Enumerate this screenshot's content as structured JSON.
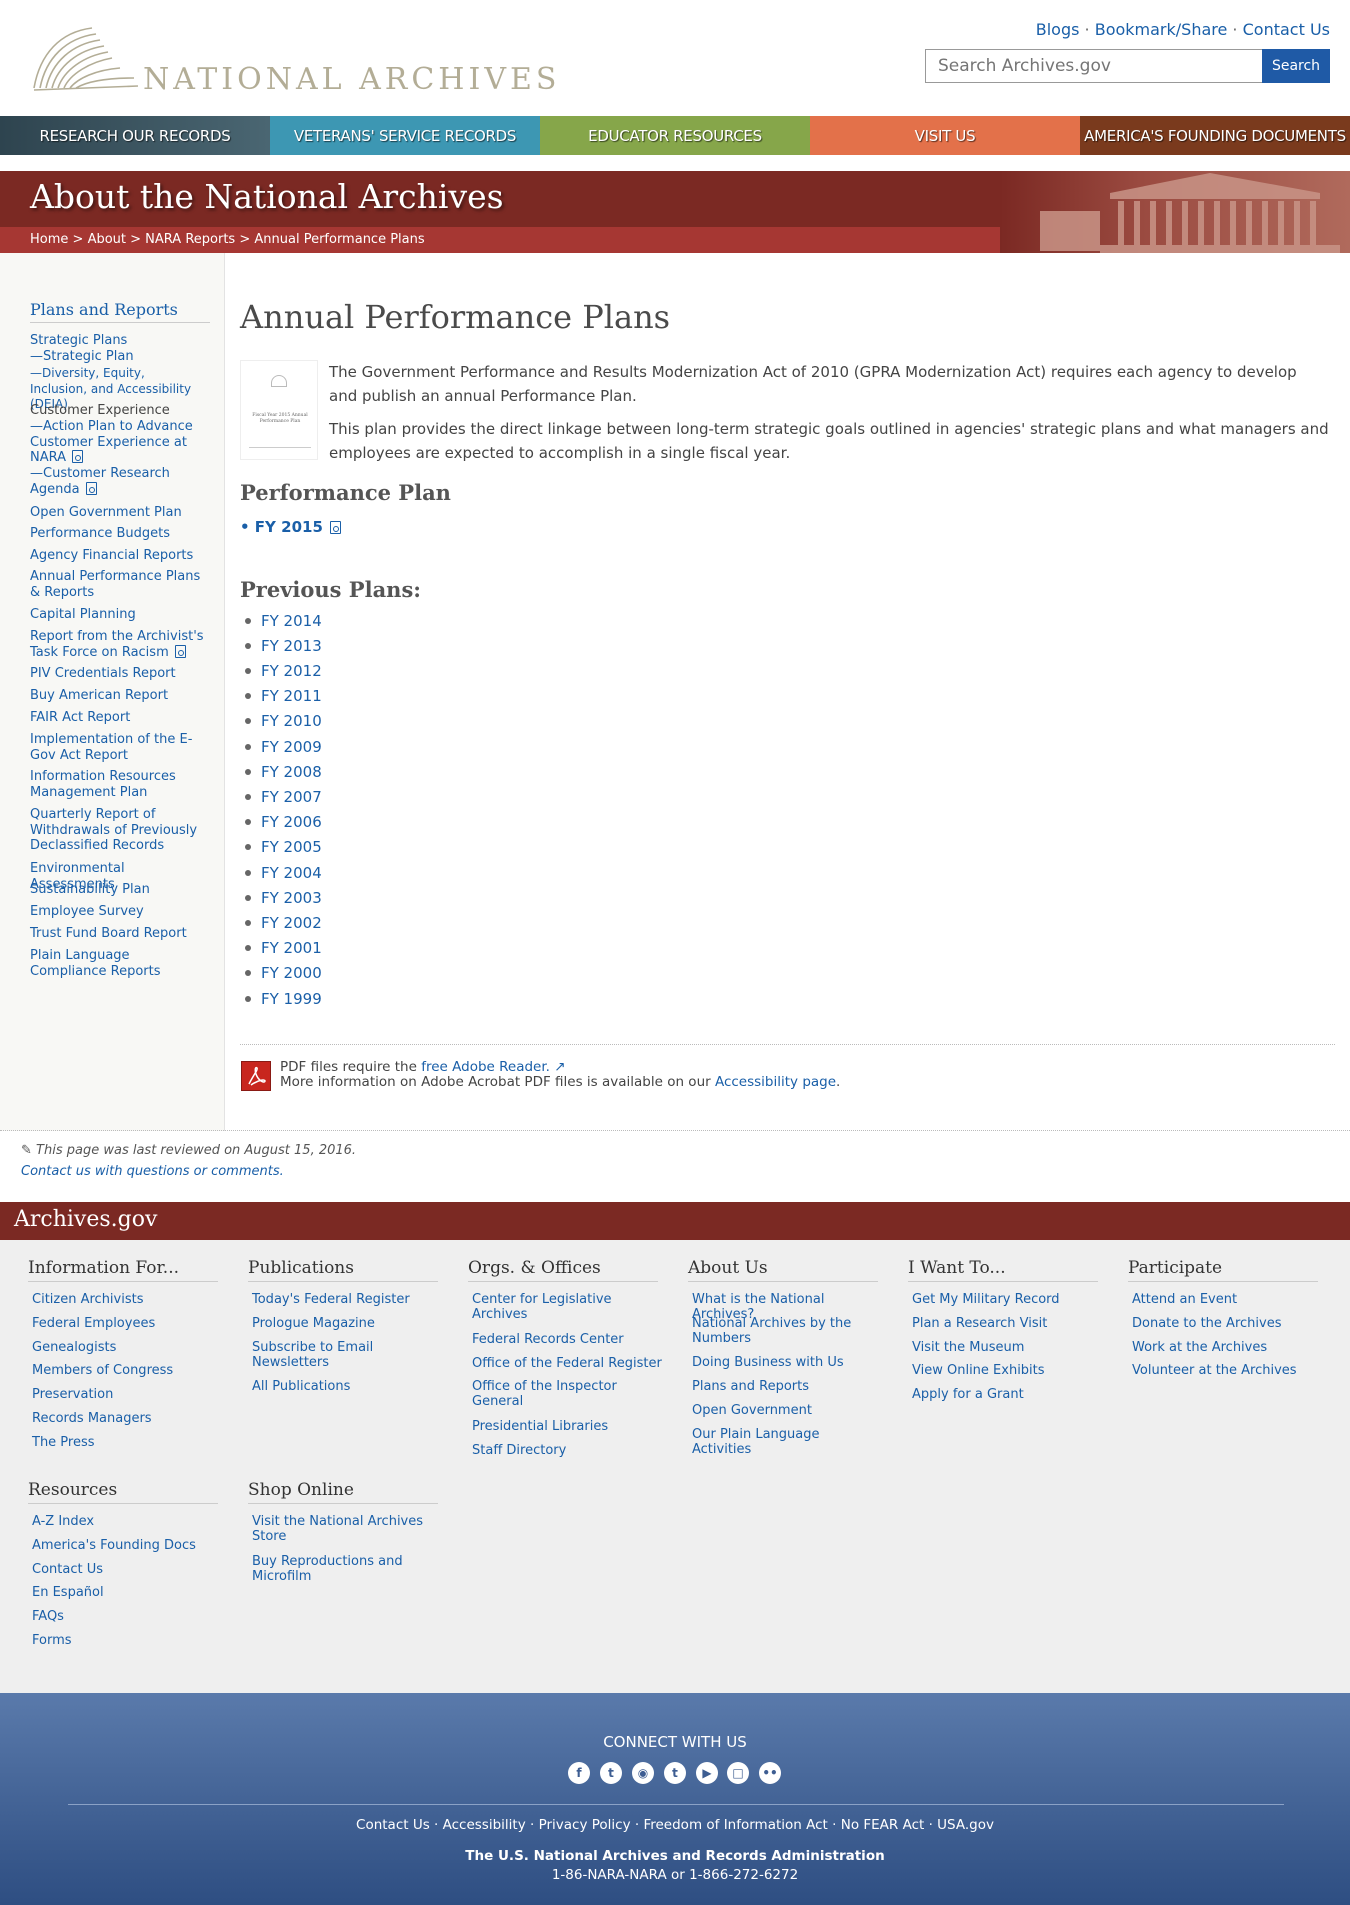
{
  "header": {
    "logo_text": "NATIONAL ARCHIVES",
    "utility": [
      "Blogs",
      "Bookmark/Share",
      "Contact Us"
    ],
    "search_placeholder": "Search Archives.gov",
    "search_button": "Search"
  },
  "nav": [
    {
      "label": "RESEARCH OUR RECORDS",
      "color": "#3e5a68"
    },
    {
      "label": "VETERANS' SERVICE RECORDS",
      "color": "#3d97b3"
    },
    {
      "label": "EDUCATOR RESOURCES",
      "color": "#86a64a"
    },
    {
      "label": "VISIT US",
      "color": "#e3714a"
    },
    {
      "label": "AMERICA'S FOUNDING DOCUMENTS",
      "color": "#7a3a1d"
    }
  ],
  "banner": {
    "title": "About the National Archives"
  },
  "breadcrumb": [
    "Home",
    "About",
    "NARA Reports",
    "Annual Performance Plans"
  ],
  "sidebar": {
    "title": "Plans and Reports",
    "strategic_plans": "Strategic Plans",
    "strategic_plan": "—Strategic Plan",
    "deia": "—Diversity, Equity, Inclusion, and Accessibility (DEIA)",
    "cx_heading": "Customer Experience",
    "cx_action_plan": "—Action Plan to Advance Customer Experience at NARA",
    "cx_research": "—Customer Research Agenda",
    "links": [
      "Open Government Plan",
      "Performance Budgets",
      "Agency Financial Reports",
      "Annual Performance Plans & Reports",
      "Capital Planning",
      "Report from the Archivist's Task Force on Racism",
      "PIV Credentials Report",
      "Buy American Report",
      "FAIR Act Report",
      "Implementation of the E-Gov Act Report",
      "Information Resources Management Plan",
      "Quarterly Report of Withdrawals of Previously Declassified Records",
      "Environmental Assessments",
      "Sustainability Plan",
      "Employee Survey",
      "Trust Fund Board Report",
      "Plain Language Compliance Reports"
    ]
  },
  "main": {
    "title": "Annual Performance Plans",
    "thumb_caption": "Fiscal Year 2015 Annual Performance Plan",
    "para1": "The Government Performance and Results Modernization Act of 2010 (GPRA Modernization Act) requires each agency to develop and publish an annual Performance Plan.",
    "para2": "This plan provides the direct linkage between long-term strategic goals outlined in agencies' strategic plans and what managers and employees are expected to accomplish in a single fiscal year.",
    "performance_plan_heading": "Performance Plan",
    "current_plan": "• FY 2015",
    "previous_heading": "Previous Plans:",
    "previous": [
      "FY 2014",
      "FY 2013",
      "FY 2012",
      "FY 2011",
      "FY 2010",
      "FY 2009",
      "FY 2008",
      "FY 2007",
      "FY 2006",
      "FY 2005",
      "FY 2004",
      "FY 2003",
      "FY 2002",
      "FY 2001",
      "FY 2000",
      "FY 1999"
    ],
    "pdf_note_pre": "PDF files require the ",
    "pdf_note_link": "free Adobe Reader.",
    "pdf_note_line2_pre": "More information on Adobe Acrobat PDF files is available on our ",
    "pdf_note_line2_link": "Accessibility page",
    "reviewed": "This page was last reviewed on August 15, 2016.",
    "contact": "Contact us with questions or comments."
  },
  "footer": {
    "brand": "Archives.gov",
    "columns": [
      {
        "title": "Information For...",
        "links": [
          "Citizen Archivists",
          "Federal Employees",
          "Genealogists",
          "Members of Congress",
          "Preservation",
          "Records Managers",
          "The Press"
        ]
      },
      {
        "title": "Publications",
        "links": [
          "Today's Federal Register",
          "Prologue Magazine",
          "Subscribe to Email Newsletters",
          "All Publications"
        ]
      },
      {
        "title": "Orgs. & Offices",
        "links": [
          "Center for Legislative Archives",
          "Federal Records Center",
          "Office of the Federal Register",
          "Office of the Inspector General",
          "Presidential Libraries",
          "Staff Directory"
        ]
      },
      {
        "title": "About Us",
        "links": [
          "What is the National Archives?",
          "National Archives by the Numbers",
          "Doing Business with Us",
          "Plans and Reports",
          "Open Government",
          "Our Plain Language Activities"
        ]
      },
      {
        "title": "I Want To...",
        "links": [
          "Get My Military Record",
          "Plan a Research Visit",
          "Visit the Museum",
          "View Online Exhibits",
          "Apply for a Grant"
        ]
      },
      {
        "title": "Participate",
        "links": [
          "Attend an Event",
          "Donate to the Archives",
          "Work at the Archives",
          "Volunteer at the Archives"
        ]
      },
      {
        "title": "Resources",
        "links": [
          "A-Z Index",
          "America's Founding Docs",
          "Contact Us",
          "En Español",
          "FAQs",
          "Forms"
        ]
      },
      {
        "title": "Shop Online",
        "links": [
          "Visit the National Archives Store",
          "Buy Reproductions and Microfilm"
        ]
      }
    ],
    "connect": "CONNECT WITH US",
    "social_icons": [
      "facebook-icon",
      "twitter-icon",
      "instagram-icon",
      "tumblr-icon",
      "youtube-icon",
      "blog-icon",
      "flickr-icon"
    ],
    "bottom_links": [
      "Contact Us",
      "Accessibility",
      "Privacy Policy",
      "Freedom of Information Act",
      "No FEAR Act",
      "USA.gov"
    ],
    "org": "The U.S. National Archives and Records Administration",
    "phone": "1-86-NARA-NARA or 1-866-272-6272"
  }
}
